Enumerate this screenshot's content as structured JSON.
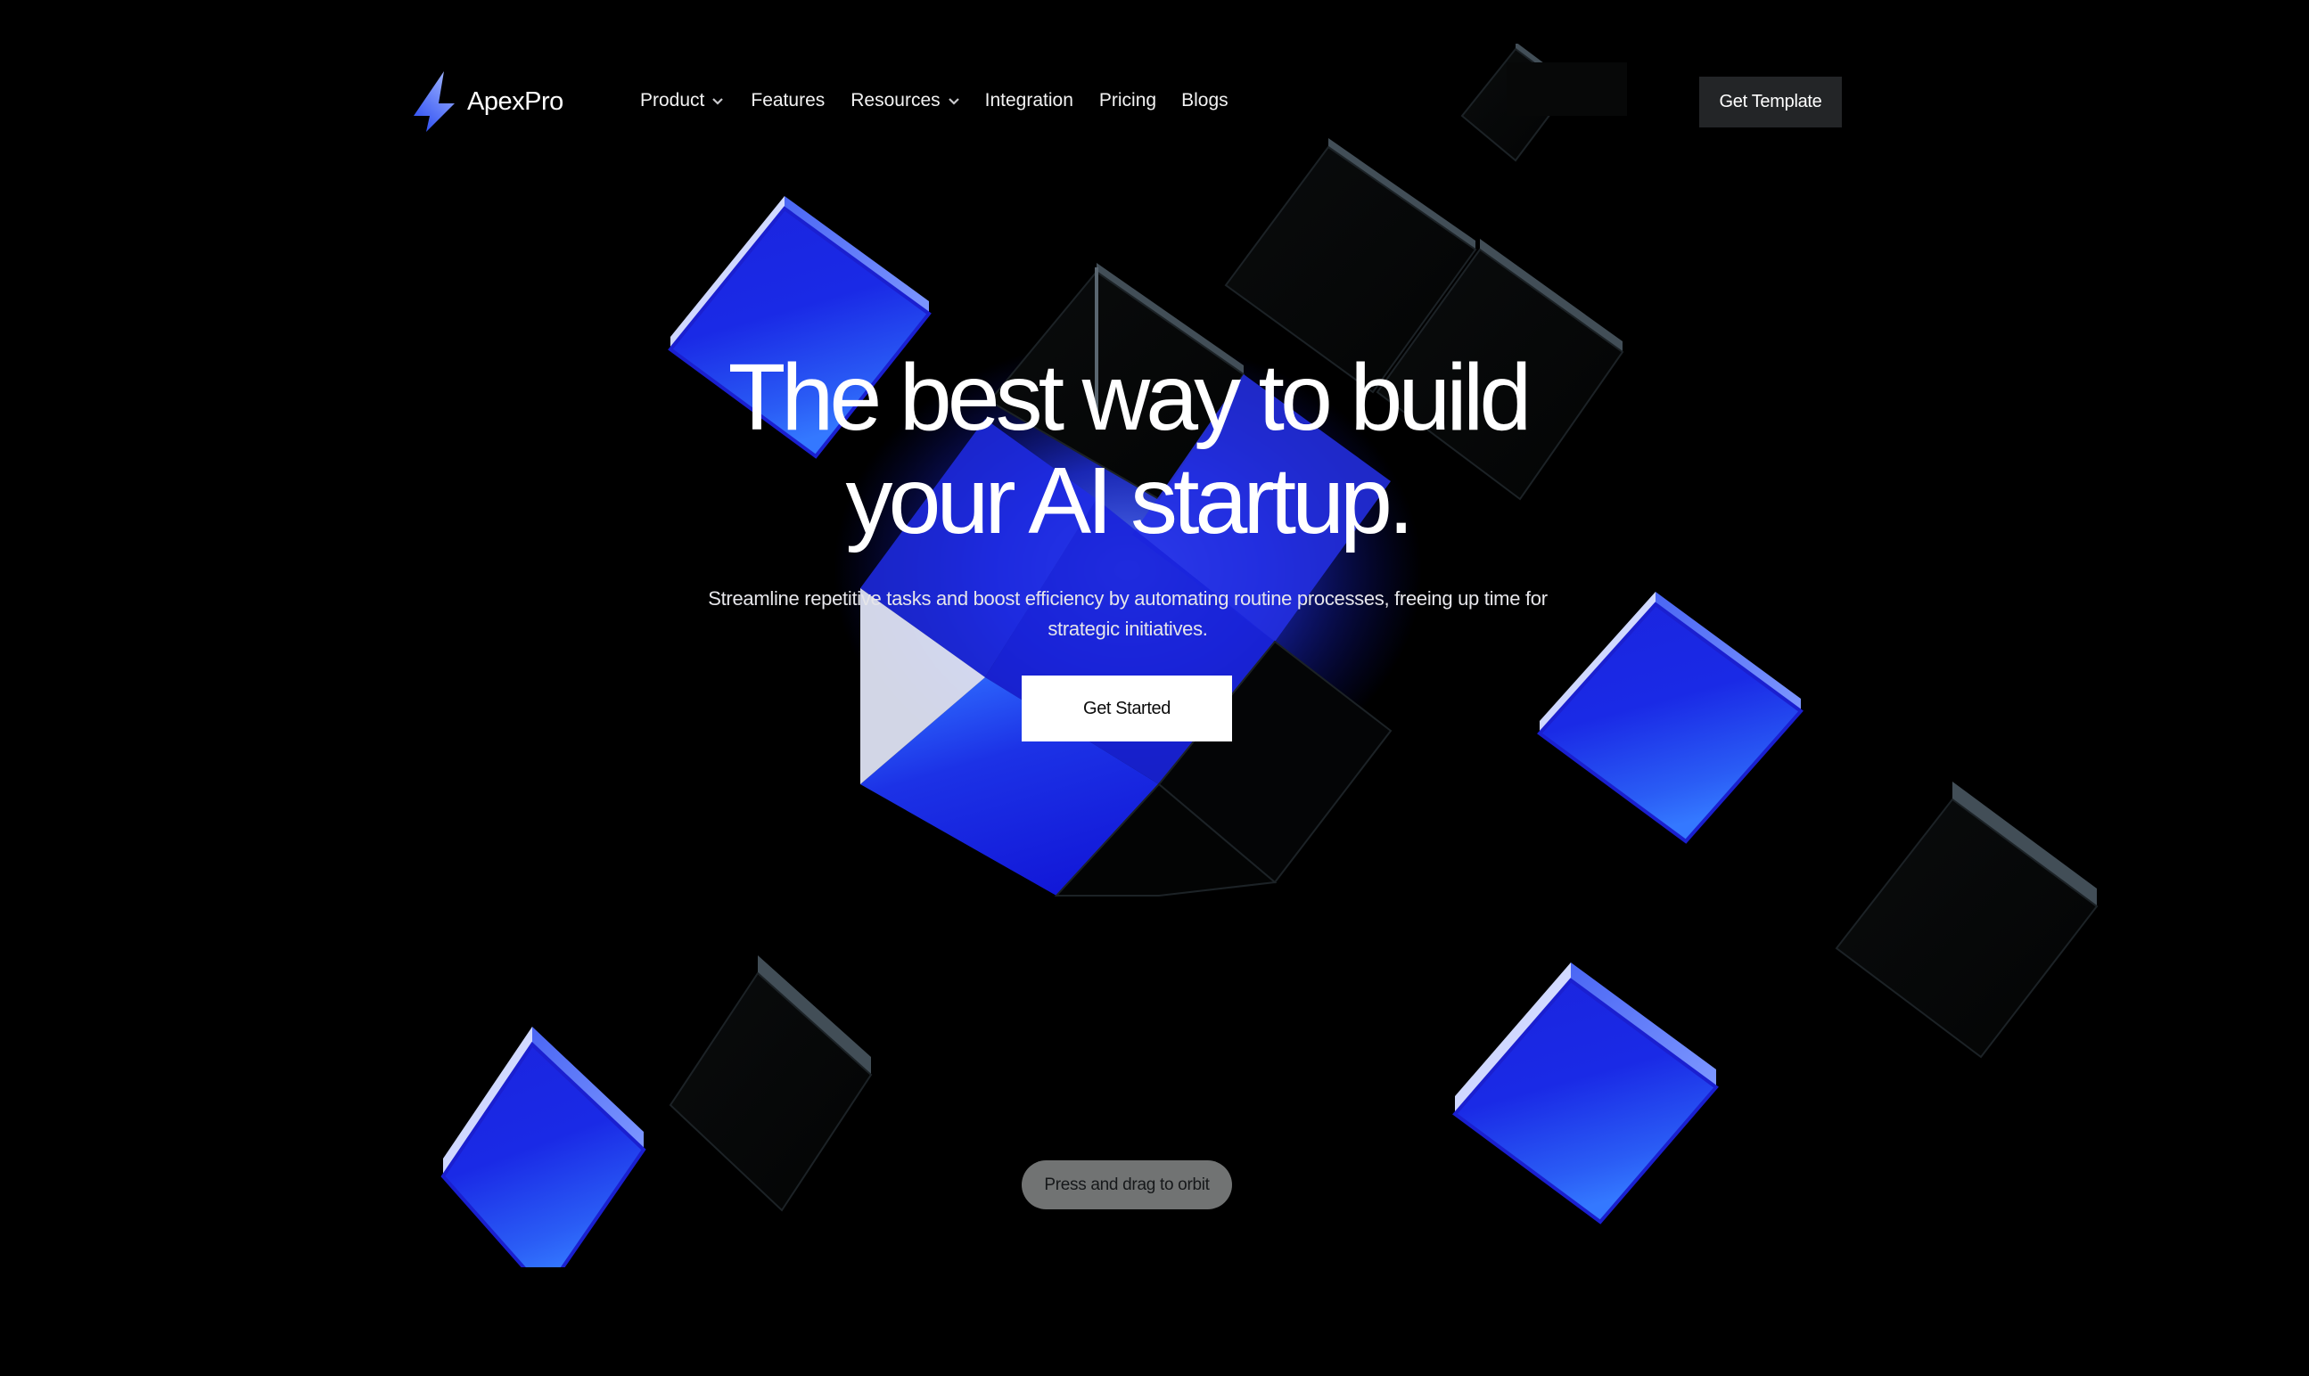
{
  "brand": {
    "name": "ApexPro",
    "logo_icon": "lightning-bolt-icon",
    "accent_color": "#2a3cf0"
  },
  "nav": {
    "items": [
      {
        "label": "Product",
        "has_dropdown": true
      },
      {
        "label": "Features",
        "has_dropdown": false
      },
      {
        "label": "Resources",
        "has_dropdown": true
      },
      {
        "label": "Integration",
        "has_dropdown": false
      },
      {
        "label": "Pricing",
        "has_dropdown": false
      },
      {
        "label": "Blogs",
        "has_dropdown": false
      }
    ],
    "cta_label": "Get Template"
  },
  "hero": {
    "title_line1": "The best way to build",
    "title_line2": "your AI startup.",
    "subtitle_line1": "Streamline repetitive tasks and boost efficiency by automating routine processes, freeing up time for",
    "subtitle_line2": "strategic initiatives.",
    "cta_label": "Get Started"
  },
  "scene": {
    "hint": "Press and drag to orbit",
    "colors": {
      "background": "#000000",
      "cube_blue": "#1a22e0",
      "cube_blue_light": "#3a7bff",
      "cube_edge_light": "#c9d2ff",
      "glass_edge": "#4a5a66"
    }
  }
}
